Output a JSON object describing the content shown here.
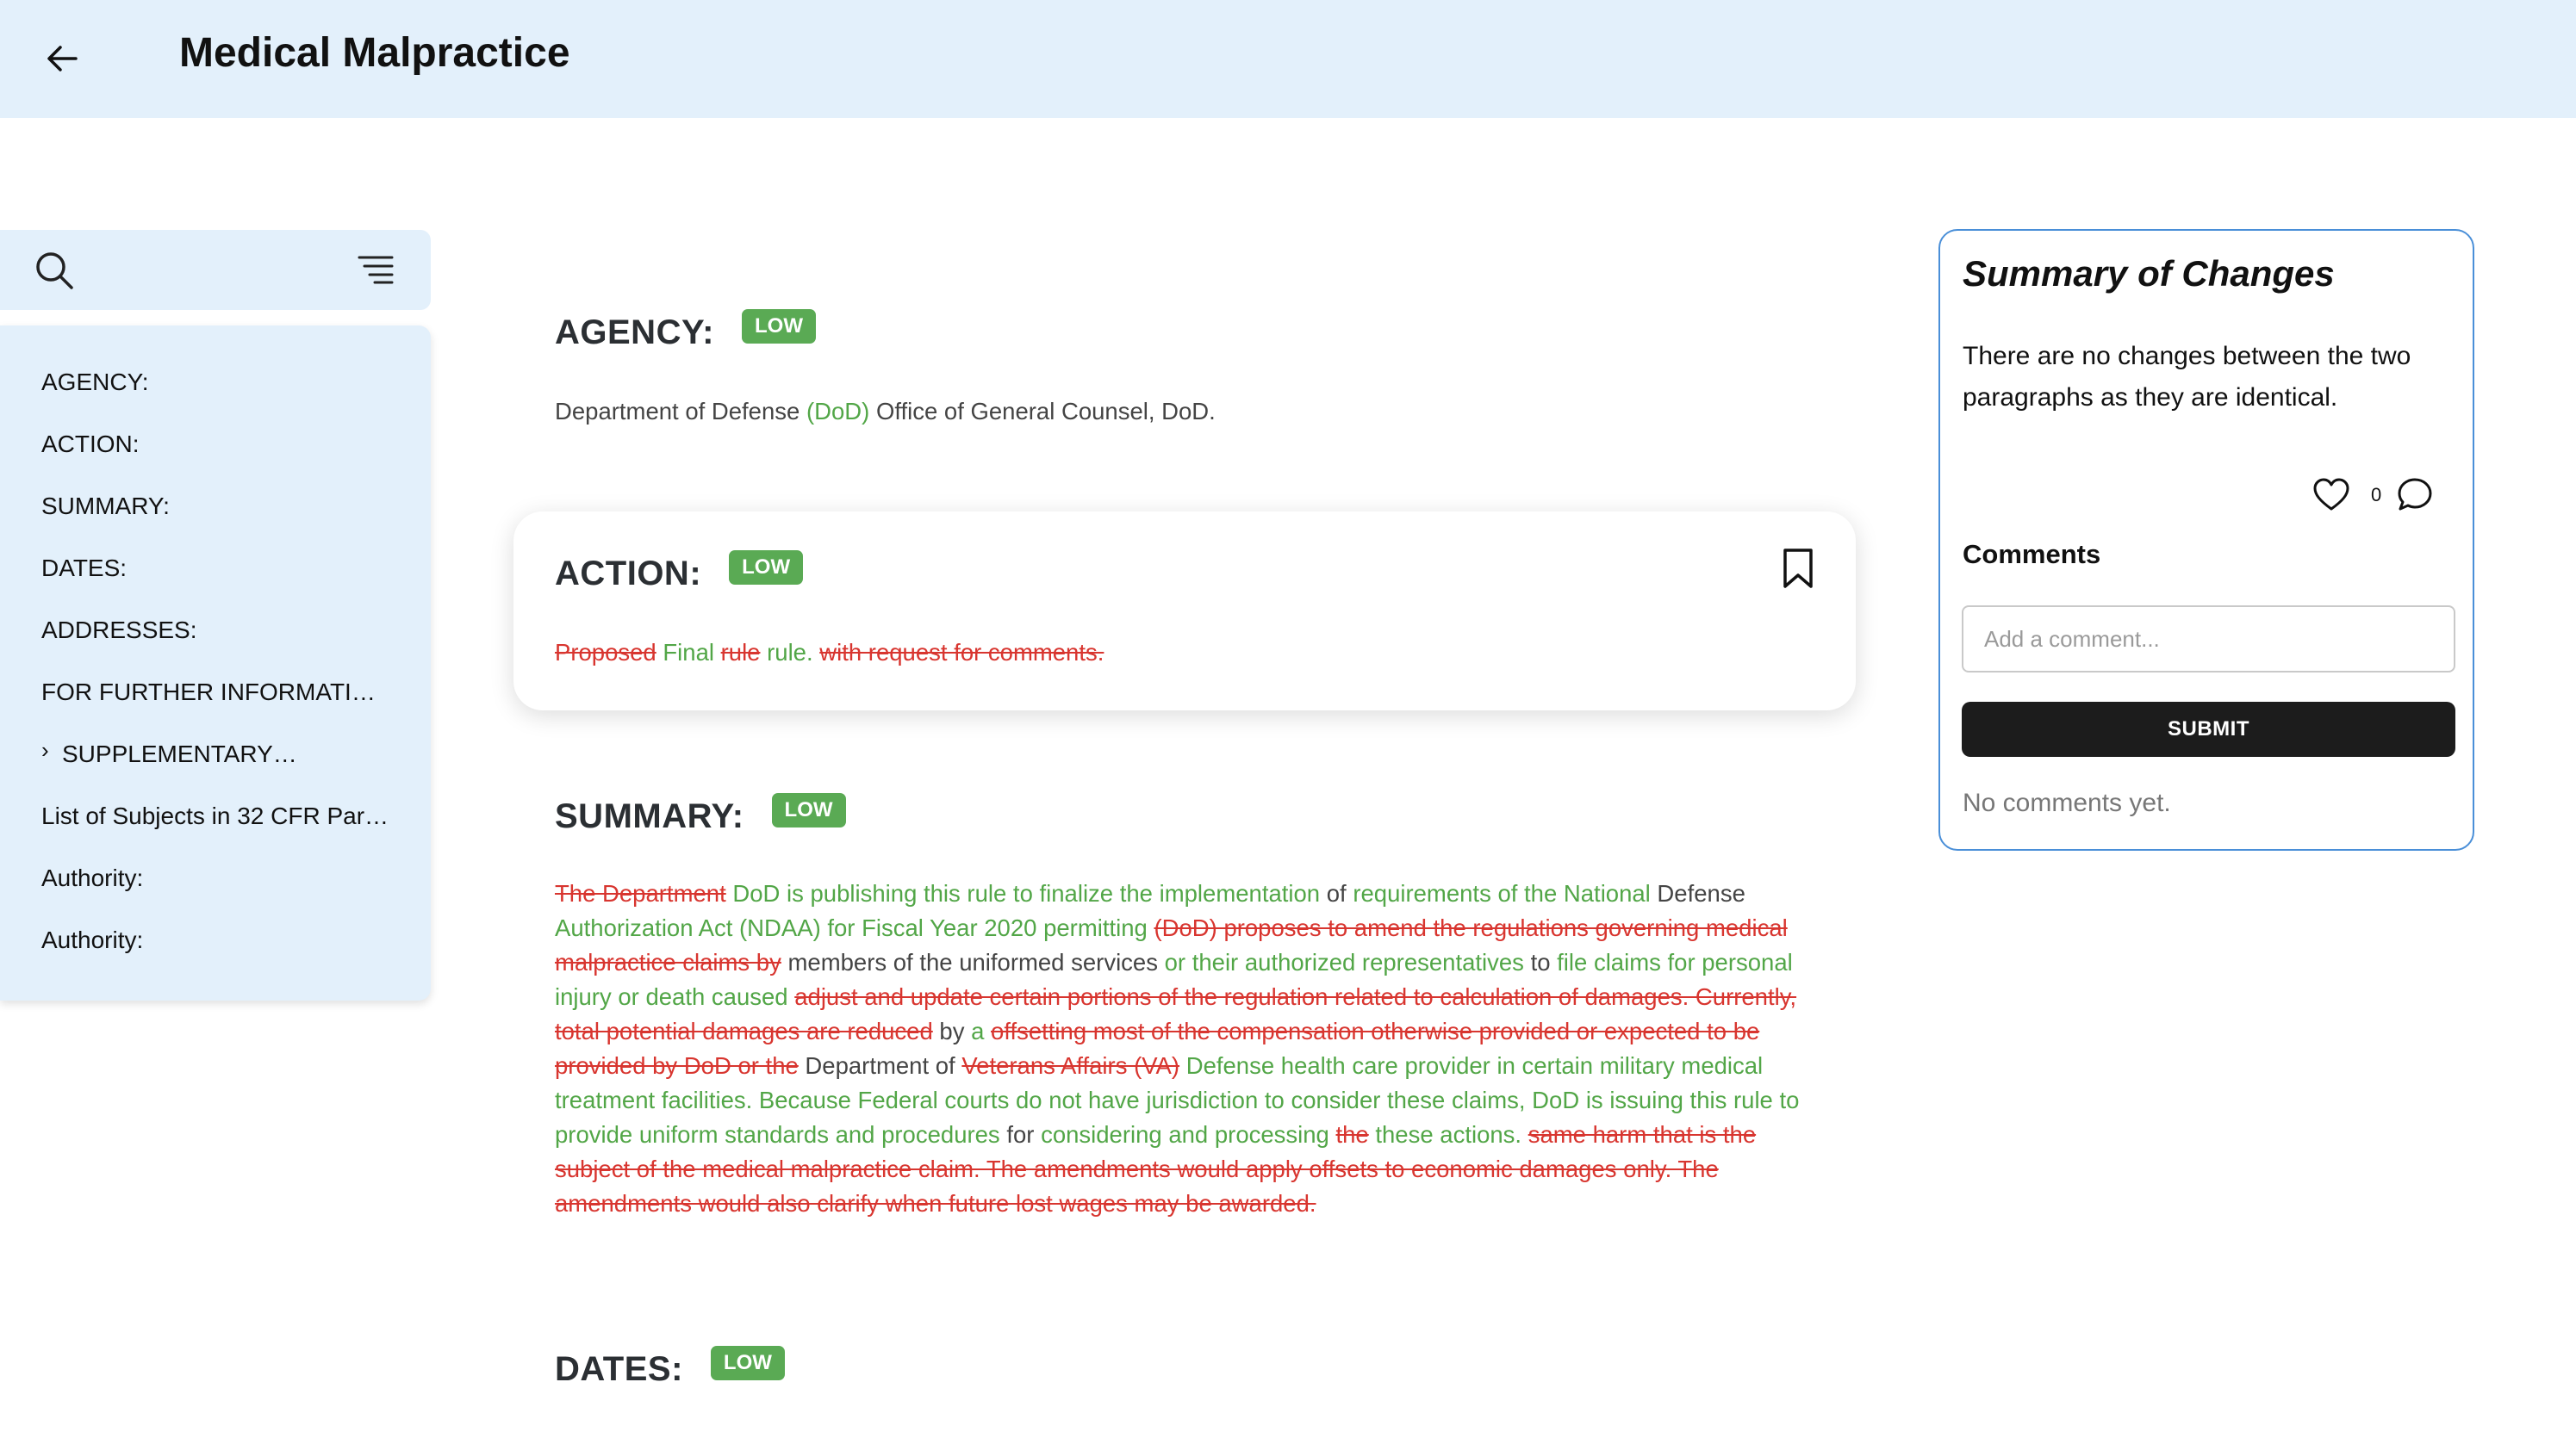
{
  "header": {
    "title": "Medical Malpractice"
  },
  "sidebar": {
    "items": [
      {
        "label": "AGENCY:"
      },
      {
        "label": "ACTION:"
      },
      {
        "label": "SUMMARY:"
      },
      {
        "label": "DATES:"
      },
      {
        "label": "ADDRESSES:"
      },
      {
        "label": "FOR FURTHER INFORMATI…"
      },
      {
        "label": "SUPPLEMENTARY…"
      },
      {
        "label": "List of Subjects in 32 CFR Par…"
      },
      {
        "label": "Authority:"
      },
      {
        "label": "Authority:"
      }
    ],
    "chevron": "›"
  },
  "sections": {
    "agency": {
      "title": "AGENCY:",
      "badge": "LOW",
      "segments": [
        {
          "t": "n",
          "text": "Department of Defense "
        },
        {
          "t": "g",
          "text": "(DoD)"
        },
        {
          "t": "n",
          "text": " Office of General Counsel, DoD."
        }
      ]
    },
    "action": {
      "title": "ACTION:",
      "badge": "LOW",
      "segments": [
        {
          "t": "r",
          "text": "Proposed"
        },
        {
          "t": "n",
          "text": " "
        },
        {
          "t": "g",
          "text": "Final"
        },
        {
          "t": "n",
          "text": " "
        },
        {
          "t": "r",
          "text": "rule"
        },
        {
          "t": "n",
          "text": " "
        },
        {
          "t": "g",
          "text": "rule."
        },
        {
          "t": "n",
          "text": " "
        },
        {
          "t": "r",
          "text": "with request for comments."
        }
      ]
    },
    "summary": {
      "title": "SUMMARY:",
      "badge": "LOW",
      "segments": [
        {
          "t": "r",
          "text": "The Department"
        },
        {
          "t": "n",
          "text": " "
        },
        {
          "t": "g",
          "text": "DoD is publishing this rule to finalize the implementation"
        },
        {
          "t": "n",
          "text": " of "
        },
        {
          "t": "g",
          "text": "requirements of the National"
        },
        {
          "t": "n",
          "text": " Defense "
        },
        {
          "t": "g",
          "text": "Authorization Act (NDAA) for Fiscal Year 2020 permitting"
        },
        {
          "t": "n",
          "text": " "
        },
        {
          "t": "r",
          "text": "(DoD) proposes to amend the regulations governing medical malpractice claims by"
        },
        {
          "t": "n",
          "text": " members of the uniformed services "
        },
        {
          "t": "g",
          "text": "or their authorized representatives"
        },
        {
          "t": "n",
          "text": " to "
        },
        {
          "t": "g",
          "text": "file claims for personal injury or death caused"
        },
        {
          "t": "n",
          "text": " "
        },
        {
          "t": "r",
          "text": "adjust and update certain portions of the regulation related to calculation of damages. Currently, total potential damages are reduced"
        },
        {
          "t": "n",
          "text": " by "
        },
        {
          "t": "g",
          "text": "a"
        },
        {
          "t": "n",
          "text": " "
        },
        {
          "t": "r",
          "text": "offsetting most of the compensation otherwise provided or expected to be provided by DoD or the"
        },
        {
          "t": "n",
          "text": " Department of "
        },
        {
          "t": "r",
          "text": "Veterans Affairs (VA)"
        },
        {
          "t": "n",
          "text": " "
        },
        {
          "t": "g",
          "text": "Defense health care provider in certain military medical treatment facilities. Because Federal courts do not have jurisdiction to consider these claims, DoD is issuing this rule to provide uniform standards and procedures"
        },
        {
          "t": "n",
          "text": " for "
        },
        {
          "t": "g",
          "text": "considering and processing"
        },
        {
          "t": "n",
          "text": " "
        },
        {
          "t": "r",
          "text": "the"
        },
        {
          "t": "n",
          "text": " "
        },
        {
          "t": "g",
          "text": "these actions."
        },
        {
          "t": "n",
          "text": " "
        },
        {
          "t": "r",
          "text": "same harm that is the subject of the medical malpractice claim. The amendments would apply offsets to economic damages only. The amendments would also clarify when future lost wages may be awarded."
        }
      ]
    },
    "dates": {
      "title": "DATES:",
      "badge": "LOW"
    }
  },
  "summary_panel": {
    "title": "Summary of Changes",
    "text": "There are no changes between the two paragraphs as they are identical.",
    "like_count": "0",
    "comments_label": "Comments",
    "comment_placeholder": "Add a comment...",
    "submit_label": "SUBMIT",
    "no_comments": "No comments yet."
  },
  "colors": {
    "added": "#52a647",
    "removed": "#d8352f",
    "badge": "#5aaa54",
    "header_bg": "#e3f0fb",
    "panel_border": "#4a8fd8"
  }
}
